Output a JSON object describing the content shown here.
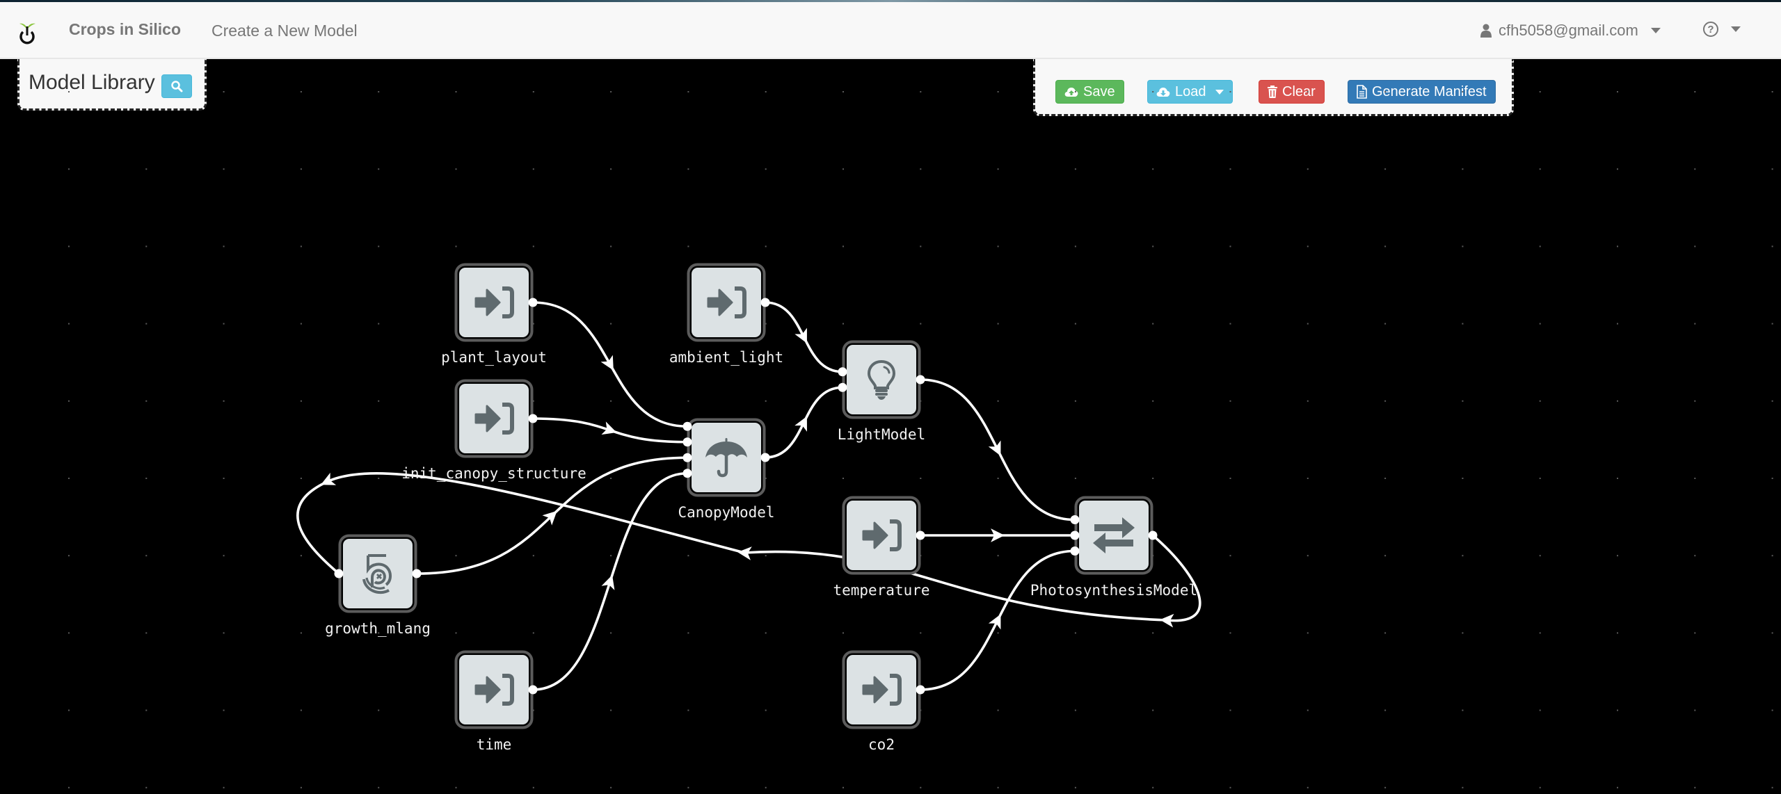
{
  "navbar": {
    "brand": "Crops in Silico",
    "links": [
      {
        "label": "Create a New Model"
      }
    ],
    "user": {
      "email": "cfh5058@gmail.com",
      "icon": "user-icon"
    },
    "help": {
      "icon": "question-circle-icon",
      "glyph": "?"
    }
  },
  "library": {
    "title": "Model Library",
    "search_icon": "search-icon"
  },
  "toolbar": {
    "save_label": "Save",
    "load_label": "Load",
    "clear_label": "Clear",
    "manifest_label": "Generate Manifest",
    "colors": {
      "save": "#5cb85c",
      "load": "#5bc0de",
      "clear": "#d9534f",
      "manifest": "#337ab7"
    }
  },
  "graph": {
    "nodes": [
      {
        "id": "plant_layout",
        "label": "plant_layout",
        "icon": "sign-in-icon"
      },
      {
        "id": "ambient_light",
        "label": "ambient_light",
        "icon": "sign-in-icon"
      },
      {
        "id": "init_canopy_structure",
        "label": "init_canopy_structure",
        "icon": "sign-in-icon"
      },
      {
        "id": "LightModel",
        "label": "LightModel",
        "icon": "lightbulb-icon"
      },
      {
        "id": "CanopyModel",
        "label": "CanopyModel",
        "icon": "umbrella-icon"
      },
      {
        "id": "temperature",
        "label": "temperature",
        "icon": "sign-in-icon"
      },
      {
        "id": "PhotosynthesisModel",
        "label": "PhotosynthesisModel",
        "icon": "exchange-icon"
      },
      {
        "id": "growth_mlang",
        "label": "growth_mlang",
        "icon": "500px-icon"
      },
      {
        "id": "time",
        "label": "time",
        "icon": "sign-in-icon"
      },
      {
        "id": "co2",
        "label": "co2",
        "icon": "sign-in-icon"
      }
    ],
    "edges": [
      {
        "from": "plant_layout",
        "to": "CanopyModel"
      },
      {
        "from": "init_canopy_structure",
        "to": "CanopyModel"
      },
      {
        "from": "growth_mlang",
        "to": "CanopyModel"
      },
      {
        "from": "time",
        "to": "CanopyModel"
      },
      {
        "from": "ambient_light",
        "to": "LightModel"
      },
      {
        "from": "CanopyModel",
        "to": "LightModel"
      },
      {
        "from": "LightModel",
        "to": "PhotosynthesisModel"
      },
      {
        "from": "temperature",
        "to": "PhotosynthesisModel"
      },
      {
        "from": "co2",
        "to": "PhotosynthesisModel"
      },
      {
        "from": "PhotosynthesisModel",
        "to": "growth_mlang"
      }
    ]
  }
}
